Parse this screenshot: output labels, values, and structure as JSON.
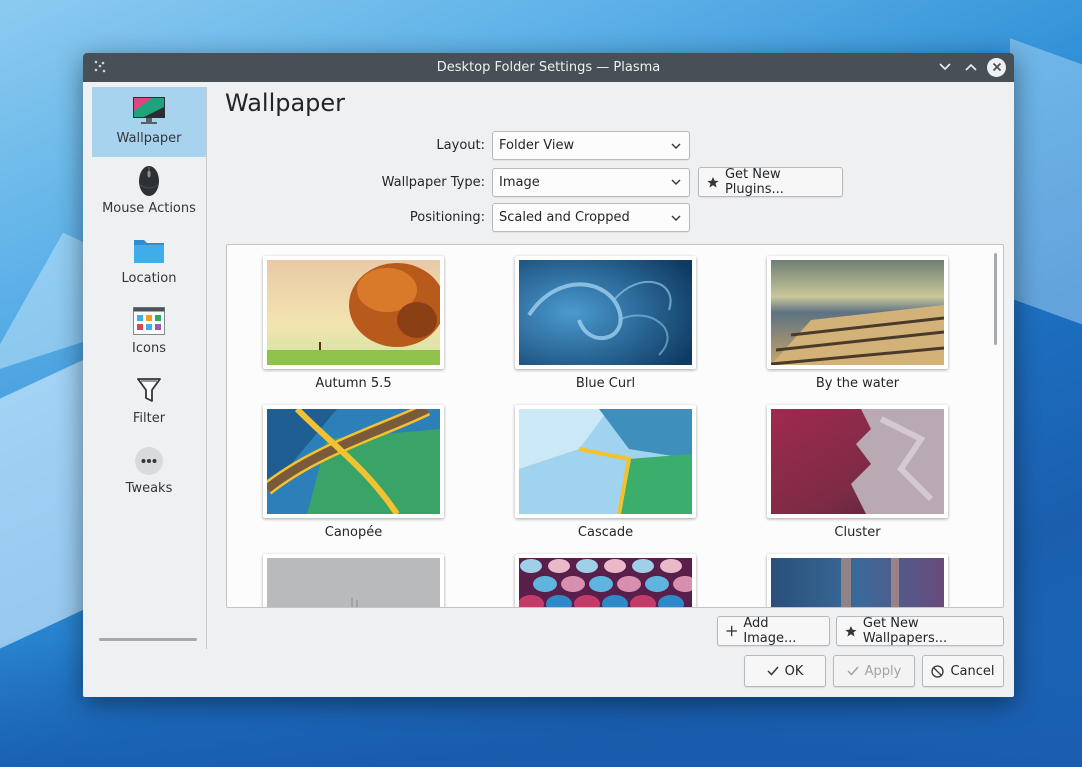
{
  "window": {
    "title": "Desktop Folder Settings — Plasma"
  },
  "sidebar": {
    "items": [
      {
        "label": "Wallpaper",
        "icon": "monitor-icon",
        "active": true
      },
      {
        "label": "Mouse Actions",
        "icon": "mouse-icon",
        "active": false
      },
      {
        "label": "Location",
        "icon": "folder-icon",
        "active": false
      },
      {
        "label": "Icons",
        "icon": "icons-grid-icon",
        "active": false
      },
      {
        "label": "Filter",
        "icon": "filter-icon",
        "active": false
      },
      {
        "label": "Tweaks",
        "icon": "more-icon",
        "active": false
      }
    ]
  },
  "main": {
    "title": "Wallpaper",
    "layout_label": "Layout:",
    "layout_value": "Folder View",
    "wallpaper_type_label": "Wallpaper Type:",
    "wallpaper_type_value": "Image",
    "get_plugins_label": "Get New Plugins...",
    "positioning_label": "Positioning:",
    "positioning_value": "Scaled and Cropped"
  },
  "wallpapers": [
    {
      "name": "Autumn 5.5"
    },
    {
      "name": "Blue Curl"
    },
    {
      "name": "By the water"
    },
    {
      "name": "Canopée"
    },
    {
      "name": "Cascade"
    },
    {
      "name": "Cluster"
    },
    {
      "name": ""
    },
    {
      "name": ""
    },
    {
      "name": ""
    }
  ],
  "buttons": {
    "add_image": "Add Image...",
    "get_wallpapers": "Get New Wallpapers...",
    "ok": "OK",
    "apply": "Apply",
    "cancel": "Cancel"
  },
  "colors": {
    "titlebar": "#475057",
    "selection": "#a8d3ee",
    "window_bg": "#eff0f1"
  }
}
